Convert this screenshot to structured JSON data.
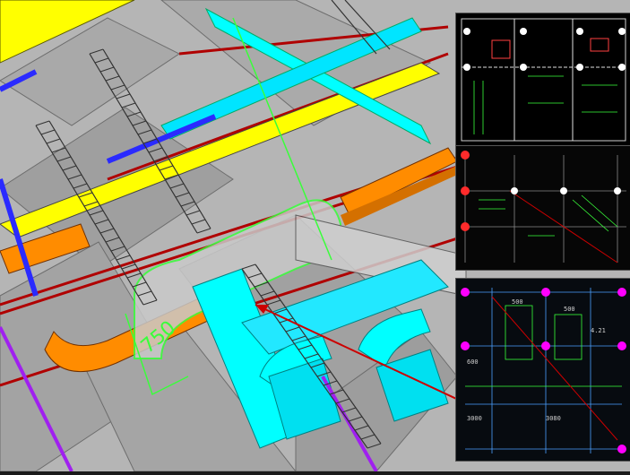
{
  "model_view": {
    "dimension_label": "750",
    "colors": {
      "background_gray": "#b9b9b9",
      "yellow_pipe": "#ffff00",
      "cyan_duct": "#00ffff",
      "orange_tray": "#ff8c00",
      "red_line": "#b00000",
      "blue_pipe": "#2a2aff",
      "purple_pipe": "#a020f0",
      "green_outline": "#39ff3a"
    }
  },
  "drawing_panels": {
    "panel_1": {
      "label": "plan-drawing-1"
    },
    "panel_2": {
      "label": "plan-drawing-2"
    },
    "panel_3": {
      "label": "section-drawing",
      "dims": [
        "500",
        "3080",
        "3000",
        "600",
        "500",
        "4.21"
      ]
    }
  }
}
